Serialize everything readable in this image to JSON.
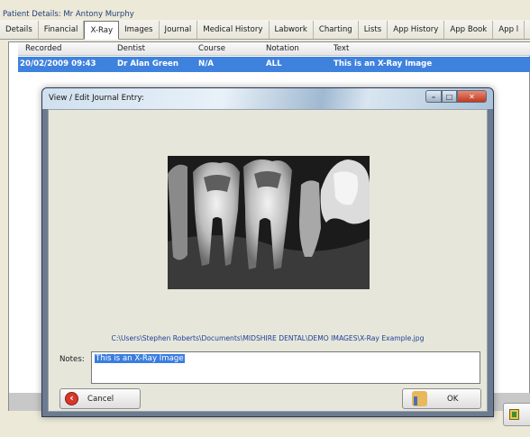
{
  "patient": {
    "title": "Patient Details: Mr Antony Murphy"
  },
  "tabs": [
    {
      "label": "Details"
    },
    {
      "label": "Financial"
    },
    {
      "label": "X-Ray"
    },
    {
      "label": "Images"
    },
    {
      "label": "Journal"
    },
    {
      "label": "Medical History"
    },
    {
      "label": "Labwork"
    },
    {
      "label": "Charting"
    },
    {
      "label": "Lists"
    },
    {
      "label": "App History"
    },
    {
      "label": "App Book"
    },
    {
      "label": "App l"
    }
  ],
  "active_tab": "X-Ray",
  "grid": {
    "columns": [
      "Recorded",
      "Dentist",
      "Course",
      "Notation",
      "Text"
    ],
    "rows": [
      {
        "recorded": "20/02/2009 09:43",
        "dentist": "Dr Alan Green",
        "course": "N/A",
        "notation": "ALL",
        "text": "This is an X-Ray Image"
      }
    ]
  },
  "dialog": {
    "title": "View / Edit Journal Entry:",
    "file_path": "C:\\Users\\Stephen Roberts\\Documents\\MIDSHIRE DENTAL\\DEMO IMAGES\\X-Ray Example.jpg",
    "notes_label": "Notes:",
    "notes_value": "This is an X-Ray Image",
    "cancel_label": "Cancel",
    "ok_label": "OK",
    "min_icon": "minimize-icon",
    "max_icon": "maximize-icon",
    "close_icon": "close-icon"
  },
  "colors": {
    "selection": "#3f82de",
    "path_text": "#1f3f9a",
    "dialog_body": "#e6e7da"
  }
}
